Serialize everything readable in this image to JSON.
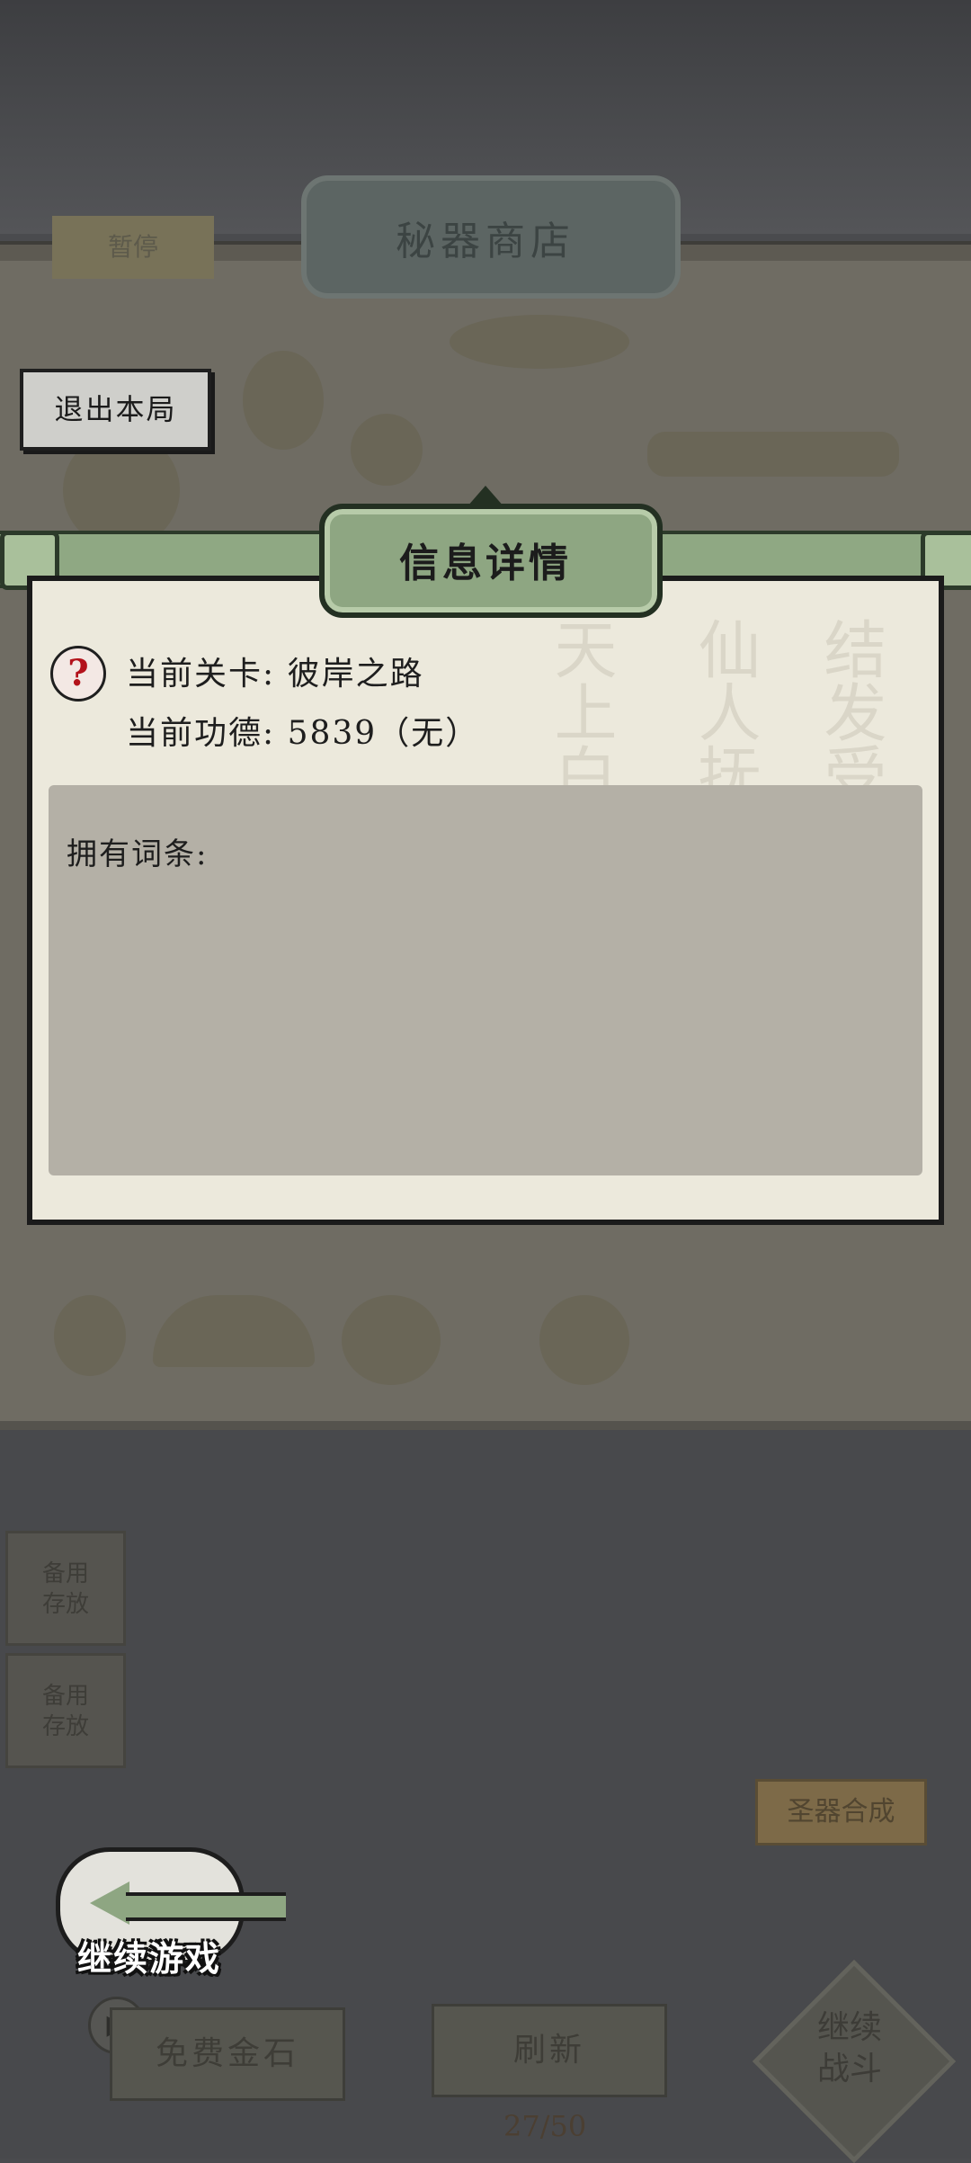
{
  "background": {
    "shop_title": "秘器商店",
    "pause_tab": "暂停",
    "synth_button": "圣器合成",
    "continue_game": "继续游戏",
    "free_gold": "免费金石",
    "refresh": "刷新",
    "continue_fight": "继续\n战斗",
    "counter": "27/50",
    "side_slot_1": "备用\n存放",
    "side_slot_2": "备用\n存放"
  },
  "exit_button": {
    "label": "退出本局"
  },
  "dialog": {
    "title": "信息详情",
    "current_level": "当前关卡: 彼岸之路",
    "current_merit": "当前功德: 5839（无）",
    "traits_label": "拥有词条:",
    "help_icon_glyph": "?"
  },
  "colors": {
    "dialog_accent": "#8ea682",
    "help_icon_red": "#b3121b"
  }
}
